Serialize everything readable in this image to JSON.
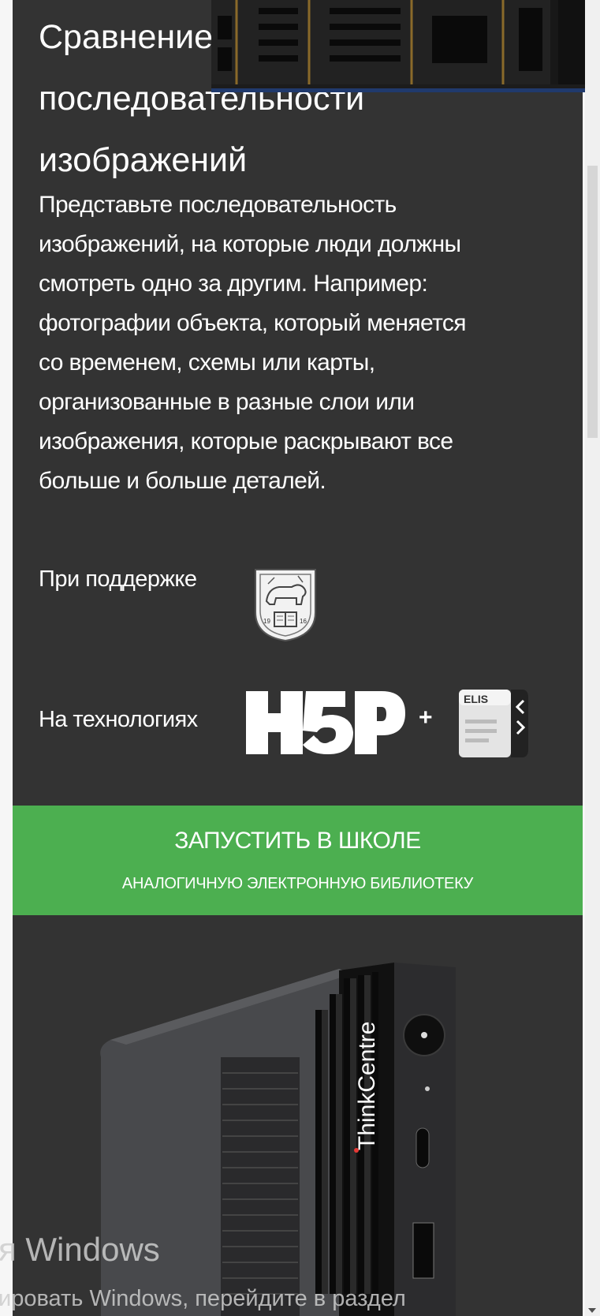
{
  "article": {
    "title_lines": [
      "Сравнение",
      "последовательности",
      "изображений"
    ],
    "description_lines": [
      "Представьте последовательность",
      "изображений, на которые люди должны",
      "смотреть одно за другим. Например:",
      "фотографии объекта, который меняется",
      "со временем, схемы или карты,",
      "организованные в разные слои или",
      "изображения, которые раскрывают все",
      "больше и больше деталей."
    ]
  },
  "credits": {
    "supported_label": "При поддержке",
    "tech_label": "На технологиях",
    "plus": "+",
    "seal_years": [
      "19",
      "16"
    ],
    "elis_label": "ELIS"
  },
  "cta": {
    "main": "ЗАПУСТИТЬ В ШКОЛЕ",
    "sub": "АНАЛОГИЧНУЮ ЭЛЕКТРОННУЮ БИБЛИОТЕКУ",
    "color": "#4caf50"
  },
  "product": {
    "brand": "ThinkCentre"
  },
  "watermark": {
    "title": "я Windows",
    "subtitle": "ировать Windows, перейдите в раздел"
  },
  "colors": {
    "panel": "#333333",
    "banner_border": "#203a6d"
  }
}
